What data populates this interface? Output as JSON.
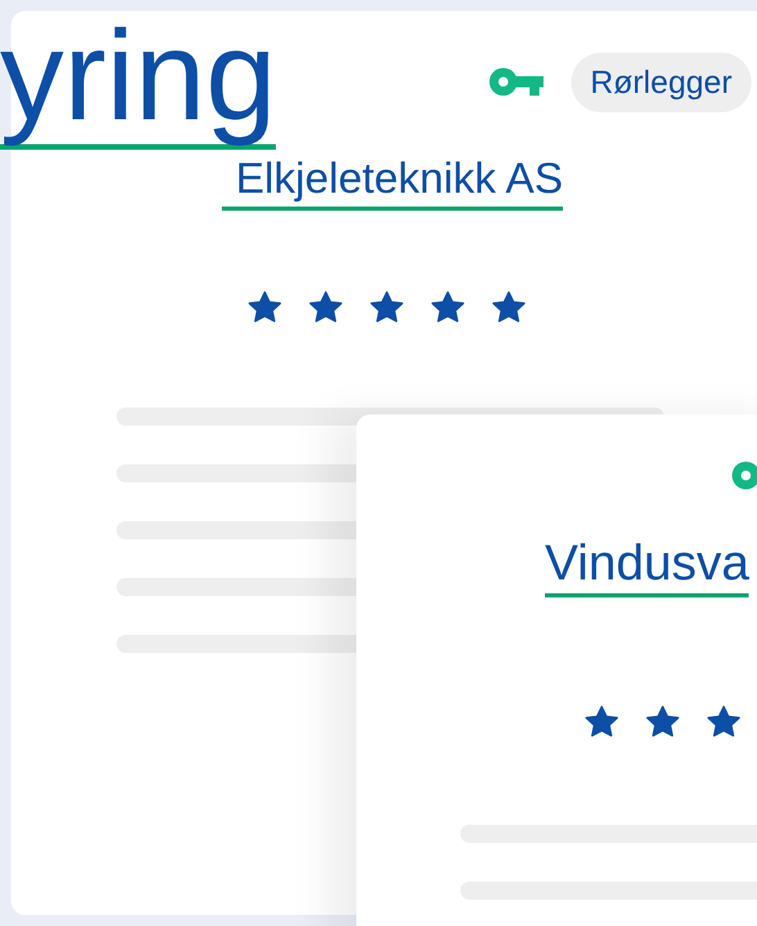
{
  "overlay_heading": "yring",
  "cards": [
    {
      "tag": "Rørlegger",
      "name": "Elkjeleteknikk AS",
      "stars": 5
    },
    {
      "name": "Vindusva",
      "stars": 3
    }
  ]
}
